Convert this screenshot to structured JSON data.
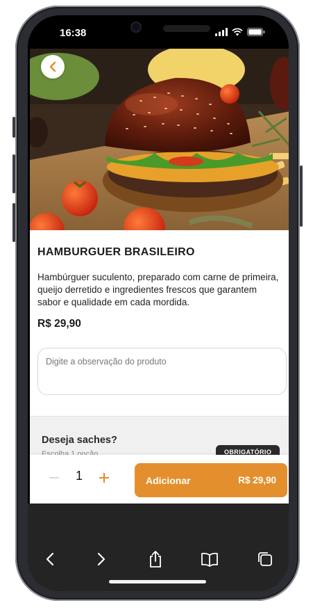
{
  "status_bar": {
    "time": "16:38"
  },
  "product": {
    "title": "HAMBURGUER BRASILEIRO",
    "description": "Hambúrguer suculento, preparado com carne de primeira, queijo derretido e ingredientes frescos que garantem sabor e qualidade em cada mordida.",
    "price": "R$ 29,90",
    "observation_placeholder": "Digite a observação do produto",
    "observation_value": ""
  },
  "options_section": {
    "title": "Deseja saches?",
    "subtitle": "Escolha 1 opção",
    "badge": "OBRIGATÓRIO"
  },
  "cart_bar": {
    "quantity": "1",
    "add_label": "Adicionar",
    "add_price": "R$ 29,90"
  },
  "colors": {
    "accent": "#e48f2d",
    "badge_bg": "#2a2a2a",
    "toolbar_bg": "#242424"
  },
  "icons": {
    "back": "chevron-left-icon",
    "minus": "minus-icon",
    "plus": "plus-icon",
    "browser_back": "chevron-left-icon",
    "browser_forward": "chevron-right-icon",
    "share": "share-icon",
    "bookmarks": "book-icon",
    "tabs": "tabs-icon"
  }
}
